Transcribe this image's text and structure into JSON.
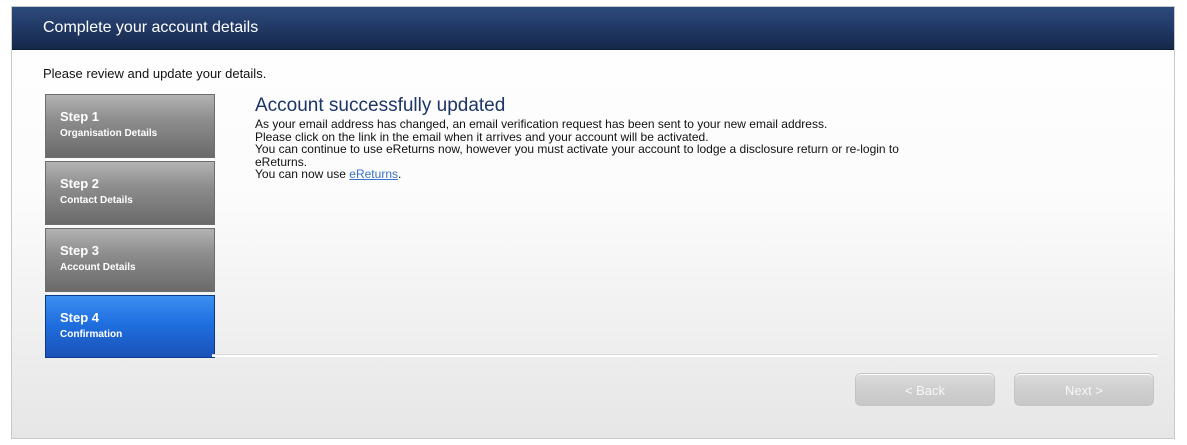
{
  "header": {
    "title": "Complete your account details"
  },
  "intro_text": "Please review and update your details.",
  "steps": [
    {
      "number": "Step 1",
      "label": "Organisation Details",
      "active": false
    },
    {
      "number": "Step 2",
      "label": "Contact Details",
      "active": false
    },
    {
      "number": "Step 3",
      "label": "Account Details",
      "active": false
    },
    {
      "number": "Step 4",
      "label": "Confirmation",
      "active": true
    }
  ],
  "content": {
    "title": "Account successfully updated",
    "line1": "As your email address has changed, an email verification request has been sent to your new email address.",
    "line2": "Please click on the link in the email when it arrives and your account will be activated.",
    "line3": "You can continue to use eReturns now, however you must activate your account to lodge a disclosure return or re-login to",
    "line4": "eReturns.",
    "line5_prefix": "You can now use ",
    "line5_link": "eReturns",
    "line5_suffix": "."
  },
  "buttons": {
    "back_label": "< Back",
    "next_label": "Next >",
    "disabled": true
  },
  "colors": {
    "header_bg": "#223a66",
    "active_step": "#1f6fe0",
    "inactive_step": "#8d8d8d",
    "title_text": "#1d3566",
    "link": "#3a72c9"
  }
}
